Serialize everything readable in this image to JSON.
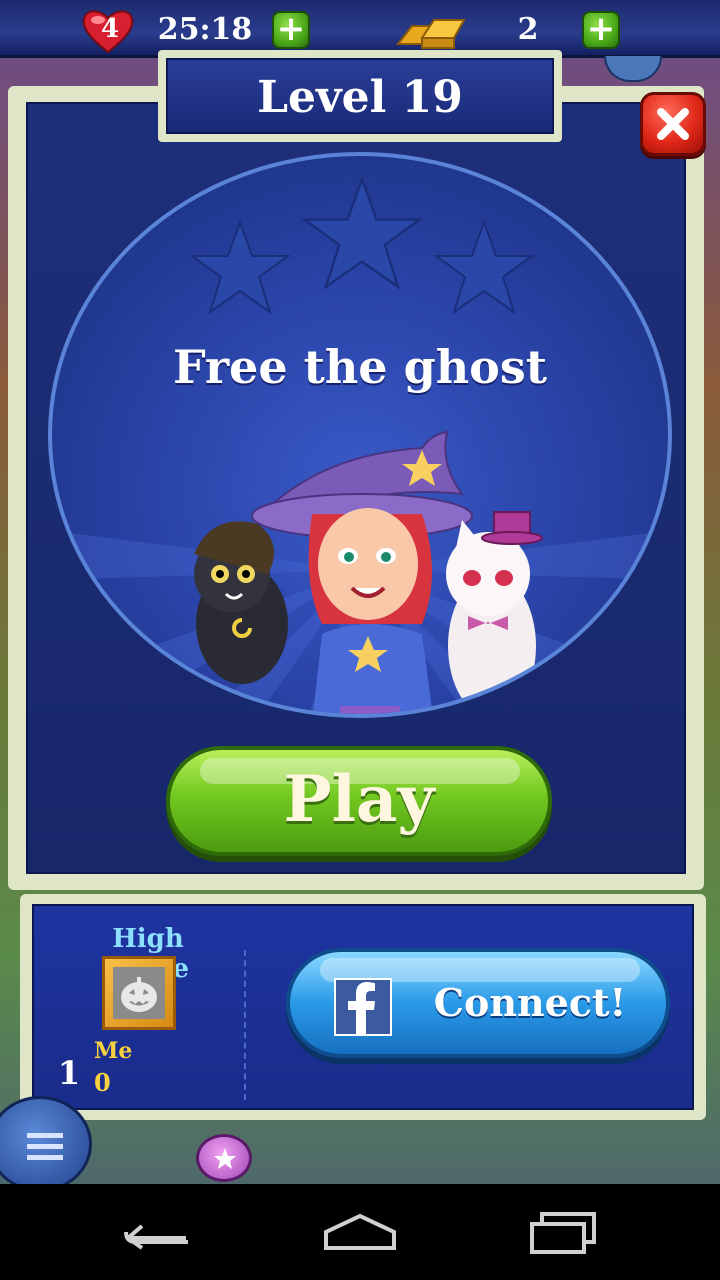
{
  "status_bar": {
    "lives": "4",
    "timer": "25:18",
    "gold": "2"
  },
  "popup": {
    "level_title": "Level 19",
    "objective": "Free the ghost",
    "play_label": "Play"
  },
  "high_score": {
    "label": "High Score",
    "rank": "1",
    "player_name": "Me",
    "player_score": "0",
    "connect_label": "Connect!"
  },
  "colors": {
    "panel_blue": "#1e2f7a",
    "frame_cream": "#dfe6c8",
    "play_green": "#72c820",
    "connect_blue": "#2a9ae8",
    "close_red": "#e02818",
    "highscore_cyan": "#8ee0ff",
    "score_gold": "#f8d040"
  },
  "icons": [
    "heart-icon",
    "plus-icon",
    "gold-bars-icon",
    "close-icon",
    "star-icon",
    "facebook-icon",
    "pumpkin-avatar-icon",
    "menu-icon",
    "back-icon",
    "home-icon",
    "recents-icon"
  ]
}
